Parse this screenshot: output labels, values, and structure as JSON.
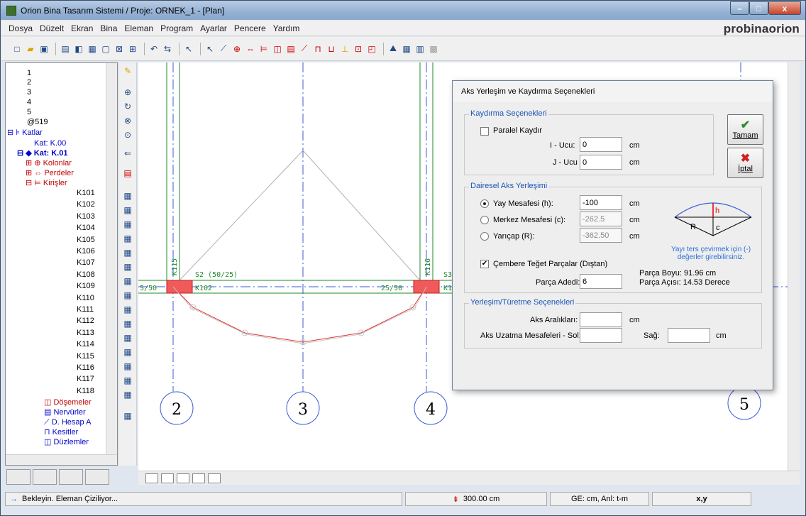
{
  "window": {
    "title": "Orion Bina Tasarım Sistemi / Proje: ORNEK_1 - [Plan]",
    "minimize": "–",
    "maximize": "□",
    "close": "x"
  },
  "brand": "probinaorion",
  "menu": [
    "Dosya",
    "Düzelt",
    "Ekran",
    "Bina",
    "Eleman",
    "Program",
    "Ayarlar",
    "Pencere",
    "Yardım"
  ],
  "tree": {
    "numbers": [
      "1",
      "2",
      "3",
      "4",
      "5",
      "@519"
    ],
    "katlar": "Katlar",
    "kat00": "Kat: K.00",
    "kat01": "Kat: K.01",
    "kolonlar": "Kolonlar",
    "perdeler": "Perdeler",
    "kirisler": "Kirişler",
    "beams": [
      "K101",
      "K102",
      "K103",
      "K104",
      "K105",
      "K106",
      "K107",
      "K108",
      "K109",
      "K110",
      "K111",
      "K112",
      "K113",
      "K114",
      "K115",
      "K116",
      "K117",
      "K118"
    ],
    "dosemeler": "Döşemeler",
    "nervurler": "Nervürler",
    "dhesap": "D. Hesap A",
    "kesitler": "Kesitler",
    "duzlemler": "Düzlemler"
  },
  "canvas": {
    "axis_labels": [
      "2",
      "3",
      "4",
      "5"
    ],
    "col_label_left": "K115",
    "col_label_right": "K116",
    "slab_label": "S2 (50/25)",
    "beam_label": "K102",
    "size_left": "5/50",
    "size_mid": "25/50",
    "s3": "S3",
    "k_right": "K1"
  },
  "dialog": {
    "title": "Aks Yerleşim ve Kaydırma Seçenekleri",
    "kaydirma": {
      "legend": "Kaydırma Seçenekleri",
      "paralel": "Paralel Kaydır",
      "i_ucu_label": "I - Ucu:",
      "i_ucu_value": "0",
      "j_ucu_label": "J - Ucu",
      "j_ucu_value": "0",
      "unit": "cm"
    },
    "dairesel": {
      "legend": "Dairesel Aks Yerleşimi",
      "yay_label": "Yay Mesafesi (h):",
      "yay_value": "-100",
      "merkez_label": "Merkez Mesafesi (c):",
      "merkez_value": "-262.5",
      "yaricap_label": "Yarıçap (R):",
      "yaricap_value": "-362.50",
      "unit": "cm",
      "hint": "Yayı ters çevirmek için (-) değerler girebilirsiniz.",
      "cembere": "Çembere Teğet Parçalar (Dıştan)",
      "parca_adedi_label": "Parça Adedi:",
      "parca_adedi_value": "6",
      "parca_boyu": "Parça Boyu: 91.96 cm",
      "parca_acisi": "Parça Açısı: 14.53 Derece",
      "diag_h": "h",
      "diag_r": "R",
      "diag_c": "c"
    },
    "yerlesim": {
      "legend": "Yerleşim/Türetme Seçenekleri",
      "aks_araliklari": "Aks Aralıkları:",
      "uzatma_sol": "Aks Uzatma Mesafeleri - Sol:",
      "sag": "Sağ:",
      "unit": "cm"
    },
    "ok": "Tamam",
    "cancel": "İptal"
  },
  "status": {
    "message": "Bekleyin. Eleman Çiziliyor...",
    "elevation": "300.00 cm",
    "units": "GE: cm,  Anl: t-m",
    "coords": "x,y"
  },
  "colors": {
    "axis_blue": "#3b5bd6",
    "beam_green": "#1d8a2a",
    "arc_red": "#e03030",
    "column_red": "#f05a5a"
  }
}
